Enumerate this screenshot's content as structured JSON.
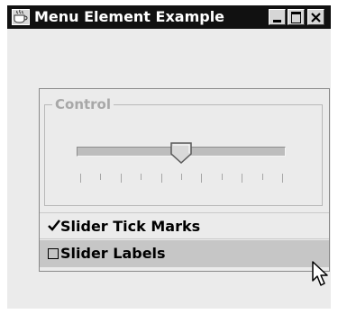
{
  "window": {
    "title": "Menu Element Example",
    "title_icon": "java-cup-icon",
    "buttons": [
      "minimize-icon",
      "maximize-icon",
      "close-icon"
    ]
  },
  "control": {
    "legend": "Control",
    "slider": {
      "value_fraction": 0.5,
      "tick_count": 11,
      "enabled": false
    }
  },
  "menu": {
    "items": [
      {
        "label": "Slider Tick Marks",
        "checked": true
      },
      {
        "label": "Slider Labels",
        "checked": false,
        "highlighted": true
      }
    ]
  },
  "colors": {
    "title_bar": "#111111",
    "window_bg": "#ebebeb",
    "highlight_bg": "#c6c6c6"
  }
}
